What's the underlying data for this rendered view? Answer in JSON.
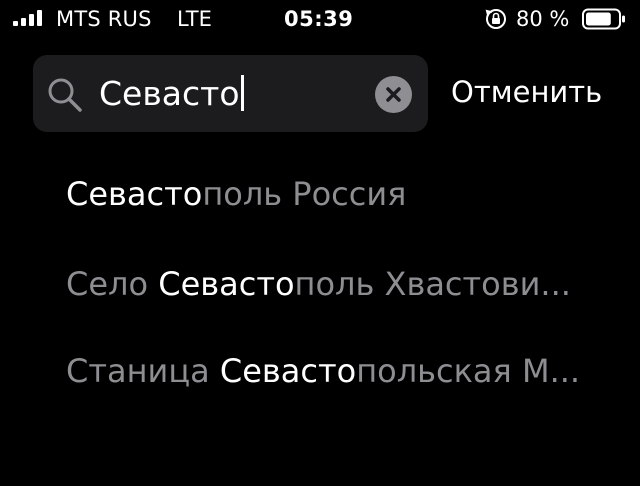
{
  "status_bar": {
    "carrier": "MTS RUS",
    "network": "LTE",
    "time": "05:39",
    "battery_percent": "80 %",
    "battery_level": 0.8,
    "icons": [
      "signal-bars-icon",
      "orientation-lock-icon",
      "battery-icon"
    ]
  },
  "search": {
    "query": "Севасто",
    "icon": "search-icon",
    "clear_icon": "clear-icon",
    "cancel_label": "Отменить"
  },
  "results": [
    {
      "prefix": "",
      "match": "Севасто",
      "suffix": "поль Россия"
    },
    {
      "prefix": "Село ",
      "match": "Севасто",
      "suffix": "поль Хвастови..."
    },
    {
      "prefix": "Станица ",
      "match": "Севасто",
      "suffix": "польская М..."
    }
  ],
  "colors": {
    "background": "#000000",
    "field_background": "#1c1c1e",
    "highlight_text": "#ffffff",
    "secondary_text": "#8d8d92"
  }
}
